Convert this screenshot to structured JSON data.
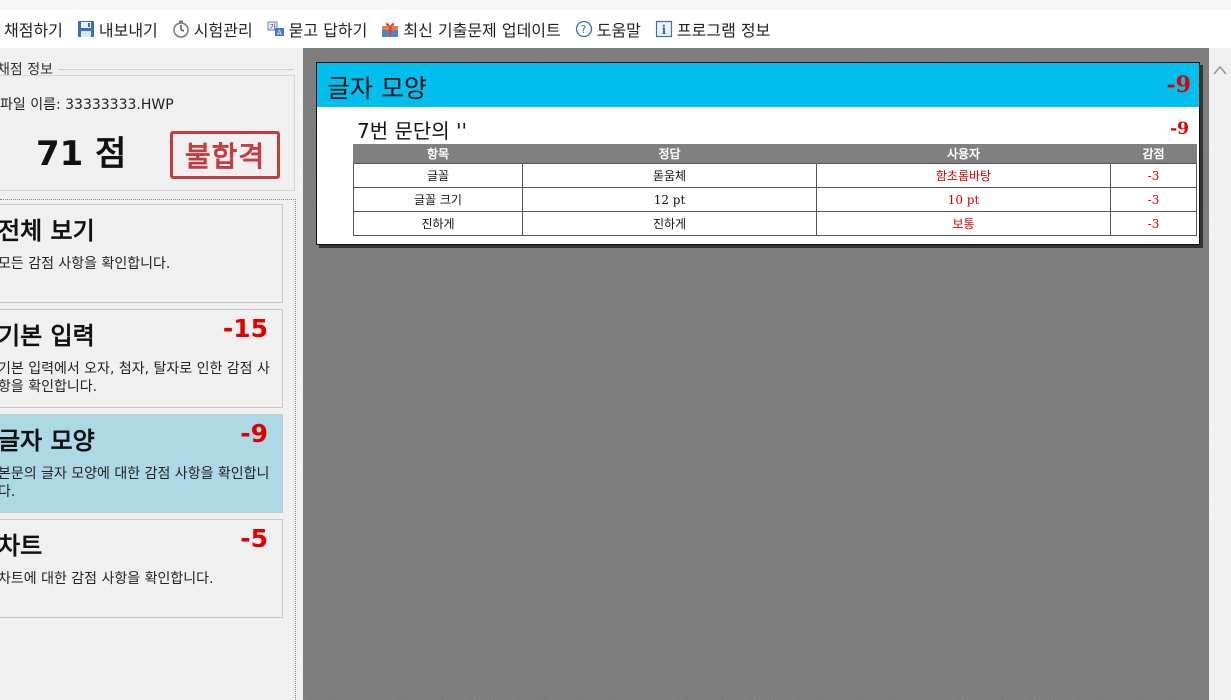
{
  "toolbar": {
    "items": [
      {
        "label": "채점하기",
        "icon": "none"
      },
      {
        "label": "내보내기",
        "icon": "floppy-icon"
      },
      {
        "label": "시험관리",
        "icon": "timer-icon"
      },
      {
        "label": "묻고 답하기",
        "icon": "qa-icon"
      },
      {
        "label": "최신 기출문제 업데이트",
        "icon": "gift-icon"
      },
      {
        "label": "도움말",
        "icon": "help-icon"
      },
      {
        "label": "프로그램 정보",
        "icon": "info-icon"
      }
    ]
  },
  "sidebar": {
    "group_title": "채점 정보",
    "file_name": "파일 이름: 33333333.HWP",
    "score": "71 점",
    "stamp": "불합격",
    "cards": [
      {
        "title": "전체 보기",
        "points": "",
        "desc": "모든 감점 사항을 확인합니다.",
        "active": false
      },
      {
        "title": "기본 입력",
        "points": "-15",
        "desc": "기본 입력에서 오자, 첨자, 탈자로 인한 감점 사항을 확인합니다.",
        "active": false
      },
      {
        "title": "글자 모양",
        "points": "-9",
        "desc": "본문의 글자 모양에 대한 감점 사항을 확인합니다.",
        "active": true
      },
      {
        "title": "차트",
        "points": "-5",
        "desc": "차트에 대한 감점 사항을 확인합니다.",
        "active": false
      }
    ]
  },
  "main": {
    "panel_title": "글자 모양",
    "panel_points": "-9",
    "paragraph_title": "7번 문단의 ''",
    "paragraph_points": "-9",
    "table": {
      "headers": [
        "항목",
        "정답",
        "사용자",
        "감점"
      ],
      "rows": [
        {
          "item": "글꼴",
          "answer": "돋움체",
          "user": "함초롬바탕",
          "deduction": "-3"
        },
        {
          "item": "글꼴 크기",
          "answer": "12 pt",
          "user": "10 pt",
          "deduction": "-3"
        },
        {
          "item": "진하게",
          "answer": "진하게",
          "user": "보통",
          "deduction": "-3"
        }
      ]
    }
  },
  "colors": {
    "header_cyan": "#00bfef",
    "active_card": "#add8e6",
    "penalty_red": "#e00000",
    "stamp_red": "#c0282d",
    "main_bg": "#7b7b7b"
  }
}
